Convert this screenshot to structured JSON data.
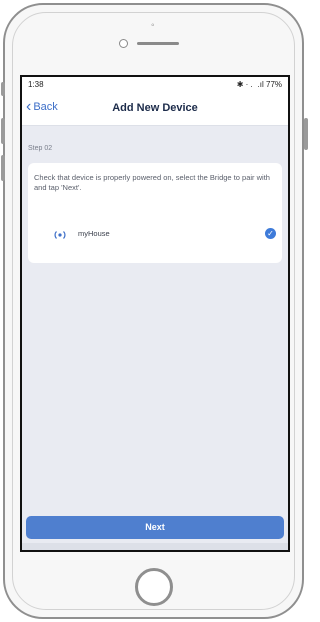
{
  "status_bar": {
    "time": "1:38",
    "right": "✱ · .   .ıl 77%"
  },
  "nav": {
    "back_label": "Back",
    "title": "Add New Device"
  },
  "step": {
    "label": "Step 02"
  },
  "card": {
    "instructions": "Check that device is properly powered on, select the Bridge to pair with and tap 'Next'.",
    "device": {
      "name": "myHouse",
      "icon": "wifi-signal-icon",
      "selected": true
    }
  },
  "next_button": {
    "label": "Next"
  },
  "colors": {
    "accent": "#4f7fcf",
    "screen_bg": "#e9ebf2",
    "check": "#3e7bd9"
  }
}
